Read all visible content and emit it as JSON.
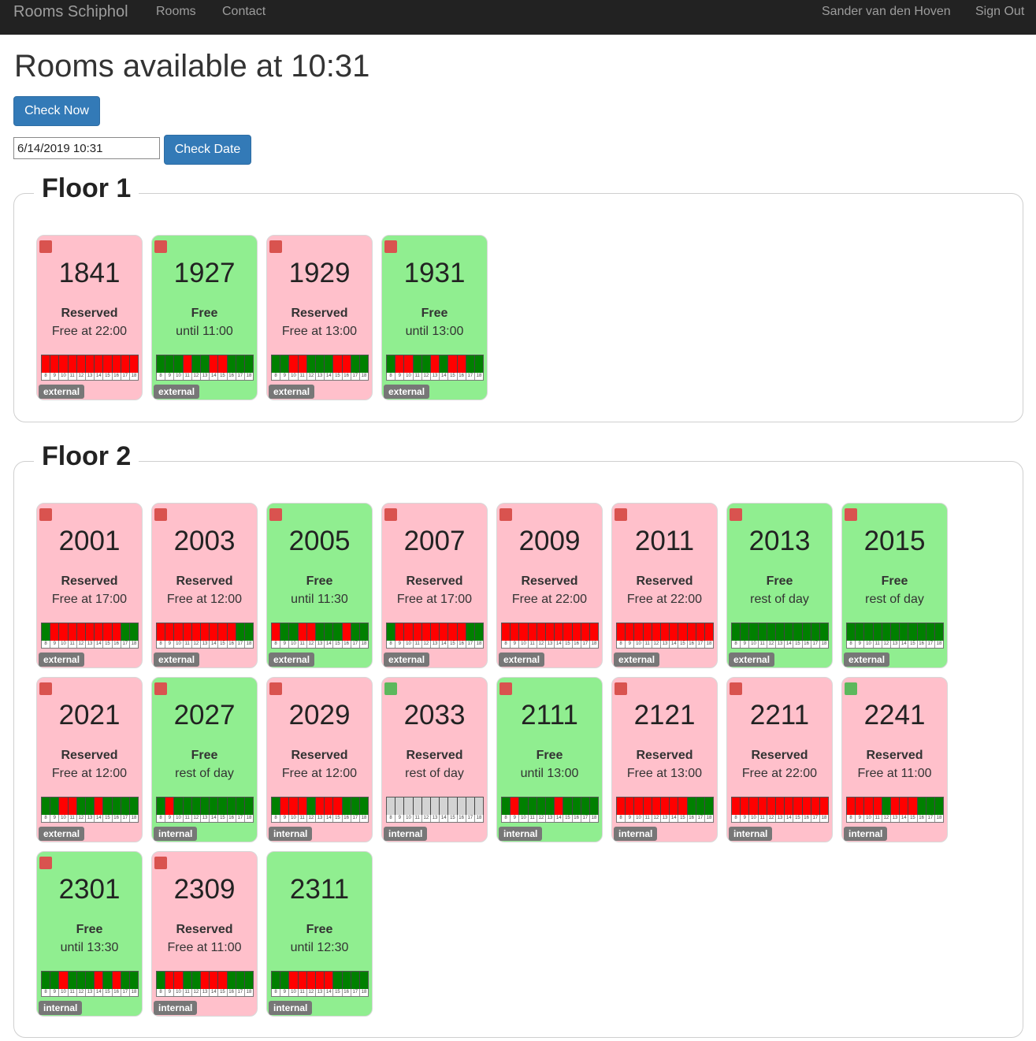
{
  "nav": {
    "brand": "Rooms Schiphol",
    "links": [
      "Rooms",
      "Contact"
    ],
    "user": "Sander van den Hoven",
    "signout": "Sign Out"
  },
  "page": {
    "title": "Rooms available at 10:31",
    "check_now": "Check Now",
    "date_value": "6/14/2019 10:31",
    "check_date": "Check Date"
  },
  "colors": {
    "free": "#90ee90",
    "reserved": "#ffc0cb",
    "slot_busy": "#ff0000",
    "slot_free": "#008000",
    "slot_unknown": "#d3d3d3"
  },
  "hour_labels": [
    "8",
    "9",
    "10",
    "11",
    "12",
    "13",
    "14",
    "15",
    "16",
    "17",
    "18"
  ],
  "floors": [
    {
      "title": "Floor 1",
      "rooms": [
        {
          "number": "1841",
          "state": "reserved",
          "status": "Reserved",
          "detail": "Free at 22:00",
          "tag": "external",
          "corner": "red",
          "slots": "rrrrrrrrrrr"
        },
        {
          "number": "1927",
          "state": "free",
          "status": "Free",
          "detail": "until 11:00",
          "tag": "external",
          "corner": "red",
          "slots": "gggrggrrggg"
        },
        {
          "number": "1929",
          "state": "reserved",
          "status": "Reserved",
          "detail": "Free at 13:00",
          "tag": "external",
          "corner": "red",
          "slots": "ggrrgggrrgg"
        },
        {
          "number": "1931",
          "state": "free",
          "status": "Free",
          "detail": "until 13:00",
          "tag": "external",
          "corner": "red",
          "slots": "grrggrgrrgg"
        }
      ]
    },
    {
      "title": "Floor 2",
      "rooms": [
        {
          "number": "2001",
          "state": "reserved",
          "status": "Reserved",
          "detail": "Free at 17:00",
          "tag": "external",
          "corner": "red",
          "slots": "grrrrrrrrgg"
        },
        {
          "number": "2003",
          "state": "reserved",
          "status": "Reserved",
          "detail": "Free at 12:00",
          "tag": "external",
          "corner": "red",
          "slots": "rrrrrrrrrgg"
        },
        {
          "number": "2005",
          "state": "free",
          "status": "Free",
          "detail": "until 11:30",
          "tag": "external",
          "corner": "red",
          "slots": "rggrrgggrgg"
        },
        {
          "number": "2007",
          "state": "reserved",
          "status": "Reserved",
          "detail": "Free at 17:00",
          "tag": "external",
          "corner": "red",
          "slots": "grrrrrrrrgg"
        },
        {
          "number": "2009",
          "state": "reserved",
          "status": "Reserved",
          "detail": "Free at 22:00",
          "tag": "external",
          "corner": "red",
          "slots": "rrrrrrrrrrr"
        },
        {
          "number": "2011",
          "state": "reserved",
          "status": "Reserved",
          "detail": "Free at 22:00",
          "tag": "external",
          "corner": "red",
          "slots": "rrrrrrrrrrr"
        },
        {
          "number": "2013",
          "state": "free",
          "status": "Free",
          "detail": "rest of day",
          "tag": "external",
          "corner": "red",
          "slots": "ggggggggggg"
        },
        {
          "number": "2015",
          "state": "free",
          "status": "Free",
          "detail": "rest of day",
          "tag": "external",
          "corner": "red",
          "slots": "ggggggggggg"
        },
        {
          "number": "2021",
          "state": "reserved",
          "status": "Reserved",
          "detail": "Free at 12:00",
          "tag": "external",
          "corner": "red",
          "slots": "ggrrggrgggg"
        },
        {
          "number": "2027",
          "state": "free",
          "status": "Free",
          "detail": "rest of day",
          "tag": "internal",
          "corner": "red",
          "slots": "grggggggggg"
        },
        {
          "number": "2029",
          "state": "reserved",
          "status": "Reserved",
          "detail": "Free at 12:00",
          "tag": "internal",
          "corner": "red",
          "slots": "grrrgrrrggg"
        },
        {
          "number": "2033",
          "state": "reserved",
          "status": "Reserved",
          "detail": "rest of day",
          "tag": "internal",
          "corner": "green",
          "slots": "xxxxxxxxxxx"
        },
        {
          "number": "2111",
          "state": "free",
          "status": "Free",
          "detail": "until 13:00",
          "tag": "internal",
          "corner": "red",
          "slots": "grggggrgggg"
        },
        {
          "number": "2121",
          "state": "reserved",
          "status": "Reserved",
          "detail": "Free at 13:00",
          "tag": "internal",
          "corner": "red",
          "slots": "rrrrrrrrggg"
        },
        {
          "number": "2211",
          "state": "reserved",
          "status": "Reserved",
          "detail": "Free at 22:00",
          "tag": "internal",
          "corner": "red",
          "slots": "rrrrrrrrrrr"
        },
        {
          "number": "2241",
          "state": "reserved",
          "status": "Reserved",
          "detail": "Free at 11:00",
          "tag": "internal",
          "corner": "green",
          "slots": "rrrrgrrrggg"
        },
        {
          "number": "2301",
          "state": "free",
          "status": "Free",
          "detail": "until 13:30",
          "tag": "internal",
          "corner": "red",
          "slots": "ggrgggrgrgg"
        },
        {
          "number": "2309",
          "state": "reserved",
          "status": "Reserved",
          "detail": "Free at 11:00",
          "tag": "internal",
          "corner": "red",
          "slots": "grrggrrrggg"
        },
        {
          "number": "2311",
          "state": "free",
          "status": "Free",
          "detail": "until 12:30",
          "tag": "internal",
          "corner": "none",
          "slots": "ggrrrrrgggg"
        }
      ]
    }
  ]
}
